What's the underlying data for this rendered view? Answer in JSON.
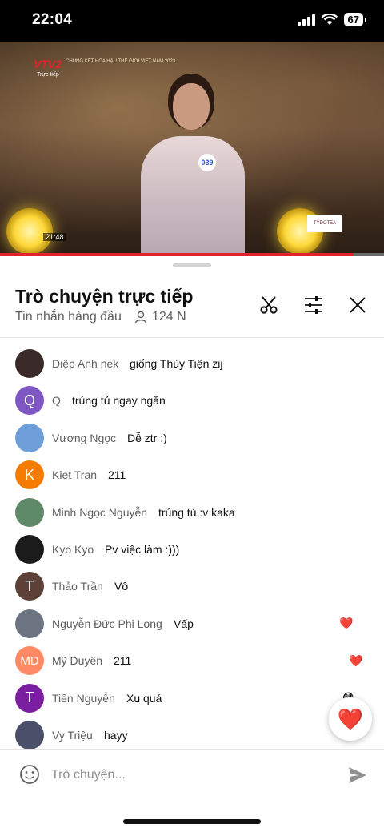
{
  "status_bar": {
    "time": "22:04",
    "battery": "67"
  },
  "video": {
    "channel": "VTV2",
    "live_label": "Trực tiếp",
    "ticker": "CHUNG KẾT HOA HẬU THẾ GIỚI VIỆT NAM 2023",
    "number_tag": "039",
    "clock": "21:48",
    "sponsor": "TYDOTEA",
    "progress": 0.92
  },
  "chat": {
    "title": "Trò chuyện trực tiếp",
    "subtitle": "Tin nhắn hàng đầu",
    "viewer_count": "124 N",
    "messages": [
      {
        "author": "Diệp Anh nek",
        "text": "giống Thùy Tiện zij",
        "avatar_letter": "",
        "avatar_color": "#3a2a2a",
        "reaction": ""
      },
      {
        "author": "Q",
        "text": "trúng tủ ngay ngăn",
        "avatar_letter": "Q",
        "avatar_color": "#7e57c2",
        "reaction": ""
      },
      {
        "author": "Vương Ngọc",
        "text": "Dễ ztr :)",
        "avatar_letter": "",
        "avatar_color": "#6f9fd8",
        "reaction": ""
      },
      {
        "author": "Kiet Tran",
        "text": "211",
        "avatar_letter": "K",
        "avatar_color": "#f57c00",
        "reaction": ""
      },
      {
        "author": "Minh Ngọc Nguyễn",
        "text": "trúng tủ :v kaka",
        "avatar_letter": "",
        "avatar_color": "#5e8a6a",
        "reaction": ""
      },
      {
        "author": "Kyo Kyo",
        "text": "Pv việc làm :)))",
        "avatar_letter": "",
        "avatar_color": "#1b1b1b",
        "reaction": ""
      },
      {
        "author": "Thảo Trần",
        "text": "Vô",
        "avatar_letter": "T",
        "avatar_color": "#5d4037",
        "reaction": ""
      },
      {
        "author": "Nguyễn Đức Phi Long",
        "text": "Vấp",
        "avatar_letter": "",
        "avatar_color": "#6b7480",
        "reaction": "❤️"
      },
      {
        "author": "Mỹ Duyên",
        "text": "211",
        "avatar_letter": "MD",
        "avatar_color": "#ff8a65",
        "reaction": "❤️"
      },
      {
        "author": "Tiến Nguyễn",
        "text": "Xu quá",
        "avatar_letter": "T",
        "avatar_color": "#7b1fa2",
        "reaction": "😳"
      },
      {
        "author": "Vy Triệu",
        "text": "hayy",
        "avatar_letter": "",
        "avatar_color": "#4a4f6a",
        "reaction": ""
      }
    ],
    "input_placeholder": "Trò chuyện...",
    "fab_reaction": "❤️"
  },
  "colors": {
    "accent": "#e3222b",
    "muted": "#606060",
    "text": "#0f0f0f"
  },
  "icons": {
    "header": [
      "scissors-icon",
      "sliders-icon",
      "close-icon"
    ],
    "input": [
      "emoji-icon",
      "send-icon"
    ]
  }
}
